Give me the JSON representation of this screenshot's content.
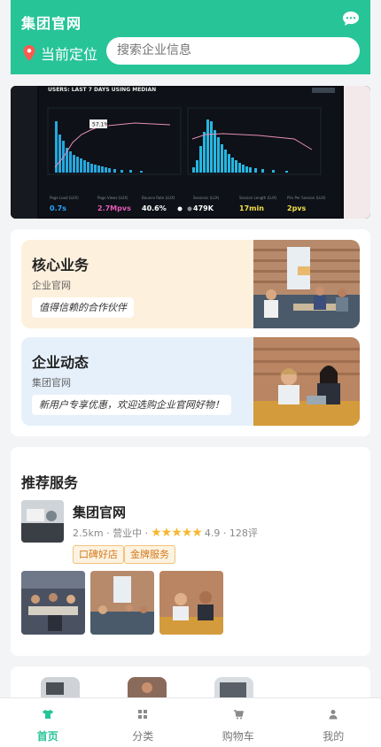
{
  "header": {
    "app_title": "集团官网",
    "location_label": "当前定位",
    "search_placeholder": "搜索企业信息"
  },
  "banner": {
    "heading": "USERS: LAST 7 DAYS USING MEDIAN",
    "tooltip_value": "57.1%",
    "stats": [
      {
        "label": "Page Load (LUX)",
        "value": "0.7s"
      },
      {
        "label": "Page Views (LUX)",
        "value": "2.7Mpvs"
      },
      {
        "label": "Bounce Rate (LUX)",
        "value": "40.6%"
      },
      {
        "label": "Sessions (LUX)",
        "value": "479K"
      },
      {
        "label": "Session Length (LUX)",
        "value": "17min"
      },
      {
        "label": "PVs Per Session (LUX)",
        "value": "2pvs"
      }
    ]
  },
  "features": [
    {
      "title": "核心业务",
      "subtitle": "企业官网",
      "tag": "值得信赖的合作伙伴",
      "bg": "#fdf0dc"
    },
    {
      "title": "企业动态",
      "subtitle": "集团官网",
      "tag": "新用户专享优惠，欢迎选购企业官网好物！",
      "bg": "#e6f0fb"
    }
  ],
  "recommend": {
    "title": "推荐服务",
    "business": {
      "name": "集团官网",
      "distance": "2.5km",
      "status": "营业中",
      "stars": "★★★★★",
      "rating": "4.9",
      "reviews": "128评",
      "badges": [
        "口碑好店",
        "金牌服务"
      ]
    }
  },
  "tabbar": {
    "items": [
      {
        "label": "首页",
        "icon": "shirt-icon",
        "active": true
      },
      {
        "label": "分类",
        "icon": "grid-icon",
        "active": false
      },
      {
        "label": "购物车",
        "icon": "cart-icon",
        "active": false
      },
      {
        "label": "我的",
        "icon": "user-icon",
        "active": false
      }
    ]
  },
  "colors": {
    "brand": "#27c498",
    "star": "#f7b731",
    "badge_text": "#d2791c"
  }
}
